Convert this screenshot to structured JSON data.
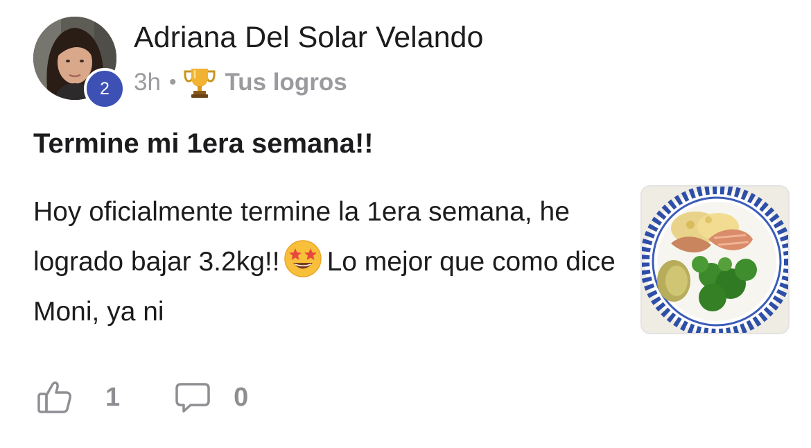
{
  "post": {
    "author": {
      "name": "Adriana Del Solar Velando",
      "level": "2",
      "avatar_icon": "profile-photo"
    },
    "meta": {
      "time": "3h",
      "separator": "•",
      "category_icon": "trophy-icon",
      "category": "Tus logros"
    },
    "title": "Termine mi 1era semana!!",
    "body": {
      "part1": "Hoy oficialmente termine la 1era semana, he logrado bajar 3.2kg!!",
      "emoji": "star-struck-emoji",
      "part2": "Lo mejor que como dice Moni, ya ni"
    },
    "thumbnail": {
      "icon": "food-photo"
    },
    "actions": {
      "like_icon": "thumbs-up-icon",
      "likes": "1",
      "comment_icon": "comment-icon",
      "comments": "0"
    }
  },
  "colors": {
    "badge": "#3d50b4",
    "text": "#1c1c1e",
    "muted": "#9a9a9f",
    "action": "#8e8e93"
  }
}
